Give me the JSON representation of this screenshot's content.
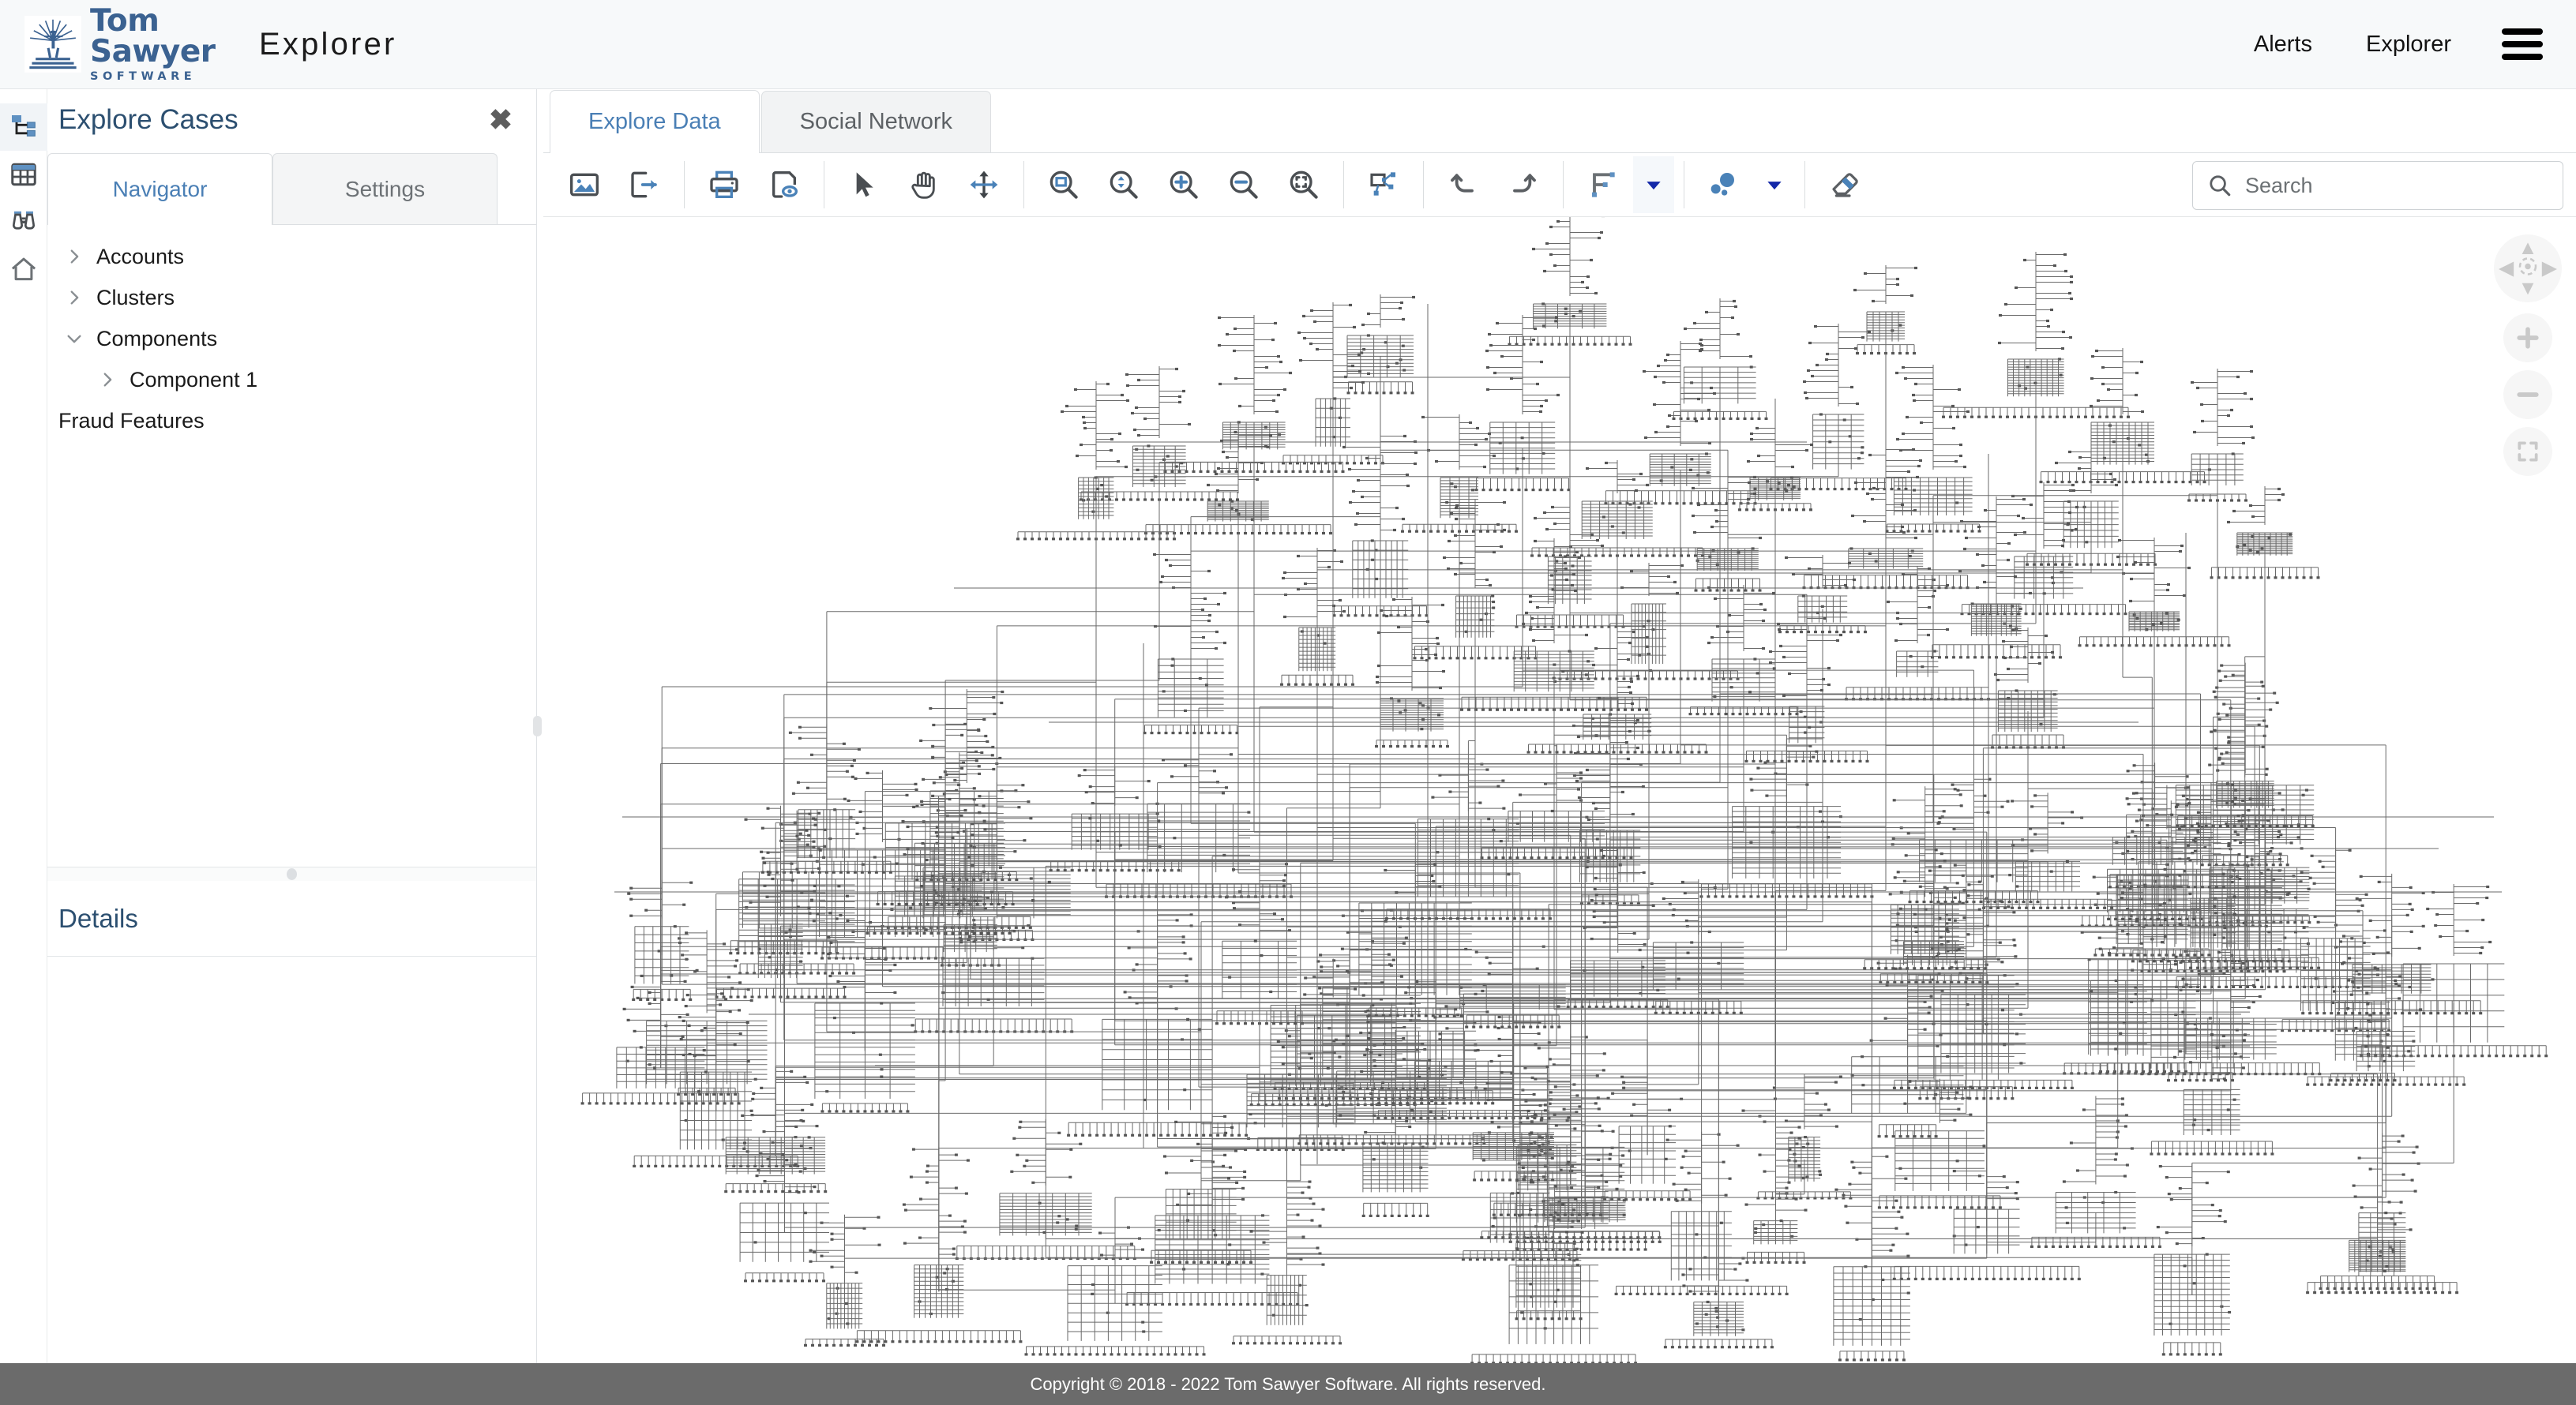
{
  "header": {
    "brand_name": "Tom Sawyer",
    "brand_sub": "SOFTWARE",
    "app_title": "Explorer",
    "nav": [
      {
        "label": "Alerts",
        "name": "alerts"
      },
      {
        "label": "Explorer",
        "name": "explorer"
      }
    ],
    "menu_icon": "hamburger-menu-icon"
  },
  "icon_rail": [
    {
      "name": "graph-view-icon",
      "active": true
    },
    {
      "name": "table-view-icon",
      "active": false
    },
    {
      "name": "binoculars-inspect-icon",
      "active": false
    },
    {
      "name": "home-icon",
      "active": false
    }
  ],
  "left_panel": {
    "title": "Explore Cases",
    "close_label": "✖",
    "tabs": [
      {
        "label": "Navigator",
        "active": true
      },
      {
        "label": "Settings",
        "active": false
      }
    ],
    "tree": [
      {
        "label": "Accounts",
        "level": 1,
        "expanded": false,
        "has_arrow": true
      },
      {
        "label": "Clusters",
        "level": 1,
        "expanded": false,
        "has_arrow": true
      },
      {
        "label": "Components",
        "level": 1,
        "expanded": true,
        "has_arrow": true
      },
      {
        "label": "Component 1",
        "level": 2,
        "expanded": false,
        "has_arrow": true
      },
      {
        "label": "Fraud Features",
        "level": 1,
        "expanded": false,
        "has_arrow": false
      }
    ],
    "details_title": "Details"
  },
  "main": {
    "tabs": [
      {
        "label": "Explore Data",
        "active": true
      },
      {
        "label": "Social Network",
        "active": false
      }
    ],
    "toolbar": [
      {
        "name": "export-image-icon",
        "title": "Export Image"
      },
      {
        "name": "export-data-icon",
        "title": "Export"
      },
      {
        "name": "separator"
      },
      {
        "name": "print-icon",
        "title": "Print"
      },
      {
        "name": "print-preview-icon",
        "title": "Print Preview"
      },
      {
        "name": "separator"
      },
      {
        "name": "select-pointer-icon",
        "title": "Select"
      },
      {
        "name": "pan-hand-icon",
        "title": "Pan"
      },
      {
        "name": "move-icon",
        "title": "Move"
      },
      {
        "name": "separator"
      },
      {
        "name": "zoom-to-fit-icon",
        "title": "Fit to Window"
      },
      {
        "name": "zoom-to-actual-icon",
        "title": "Actual Size"
      },
      {
        "name": "zoom-in-icon",
        "title": "Zoom In"
      },
      {
        "name": "zoom-out-icon",
        "title": "Zoom Out"
      },
      {
        "name": "zoom-to-selection-icon",
        "title": "Zoom To Selection"
      },
      {
        "name": "separator"
      },
      {
        "name": "select-neighbors-icon",
        "title": "Select Neighbors"
      },
      {
        "name": "separator"
      },
      {
        "name": "undo-icon",
        "title": "Undo"
      },
      {
        "name": "redo-icon",
        "title": "Redo"
      },
      {
        "name": "separator"
      },
      {
        "name": "layout-icon",
        "title": "Layout"
      },
      {
        "name": "layout-dropdown-caret-icon",
        "title": "Layout Options"
      },
      {
        "name": "separator"
      },
      {
        "name": "node-size-icon",
        "title": "Node Sizing"
      },
      {
        "name": "node-size-dropdown-caret-icon",
        "title": "Node Sizing Options"
      },
      {
        "name": "separator"
      },
      {
        "name": "eraser-clear-icon",
        "title": "Clear"
      }
    ],
    "search": {
      "placeholder": "Search",
      "value": "",
      "icon": "search-icon"
    },
    "nav_controls": [
      {
        "name": "pan-compass-control",
        "glyph": "compass"
      },
      {
        "name": "zoom-in-control",
        "glyph": "+"
      },
      {
        "name": "zoom-out-control",
        "glyph": "–"
      },
      {
        "name": "fit-to-screen-control",
        "glyph": "fit"
      }
    ]
  },
  "footer": {
    "copyright": "Copyright © 2018 - 2022 Tom Sawyer Software. All rights reserved."
  },
  "colors": {
    "brand_blue": "#3b6291",
    "accent_blue": "#4a7fb5",
    "title_navy": "#2c4f70",
    "icon_gray": "#5b5f63",
    "icon_blue": "#4a82b8",
    "footer_bg": "#6b6b6b",
    "header_bg": "#f7f9fa",
    "graph_stroke": "#6a6a6a"
  },
  "graph": {
    "type": "orthogonal-node-link-diagram",
    "description": "Dense hierarchical fraud-network graph: hub nodes with comb-like fan-outs of leaf nodes connected by orthogonal edges",
    "node_count_approx": 2400,
    "edge_routing": "orthogonal"
  }
}
